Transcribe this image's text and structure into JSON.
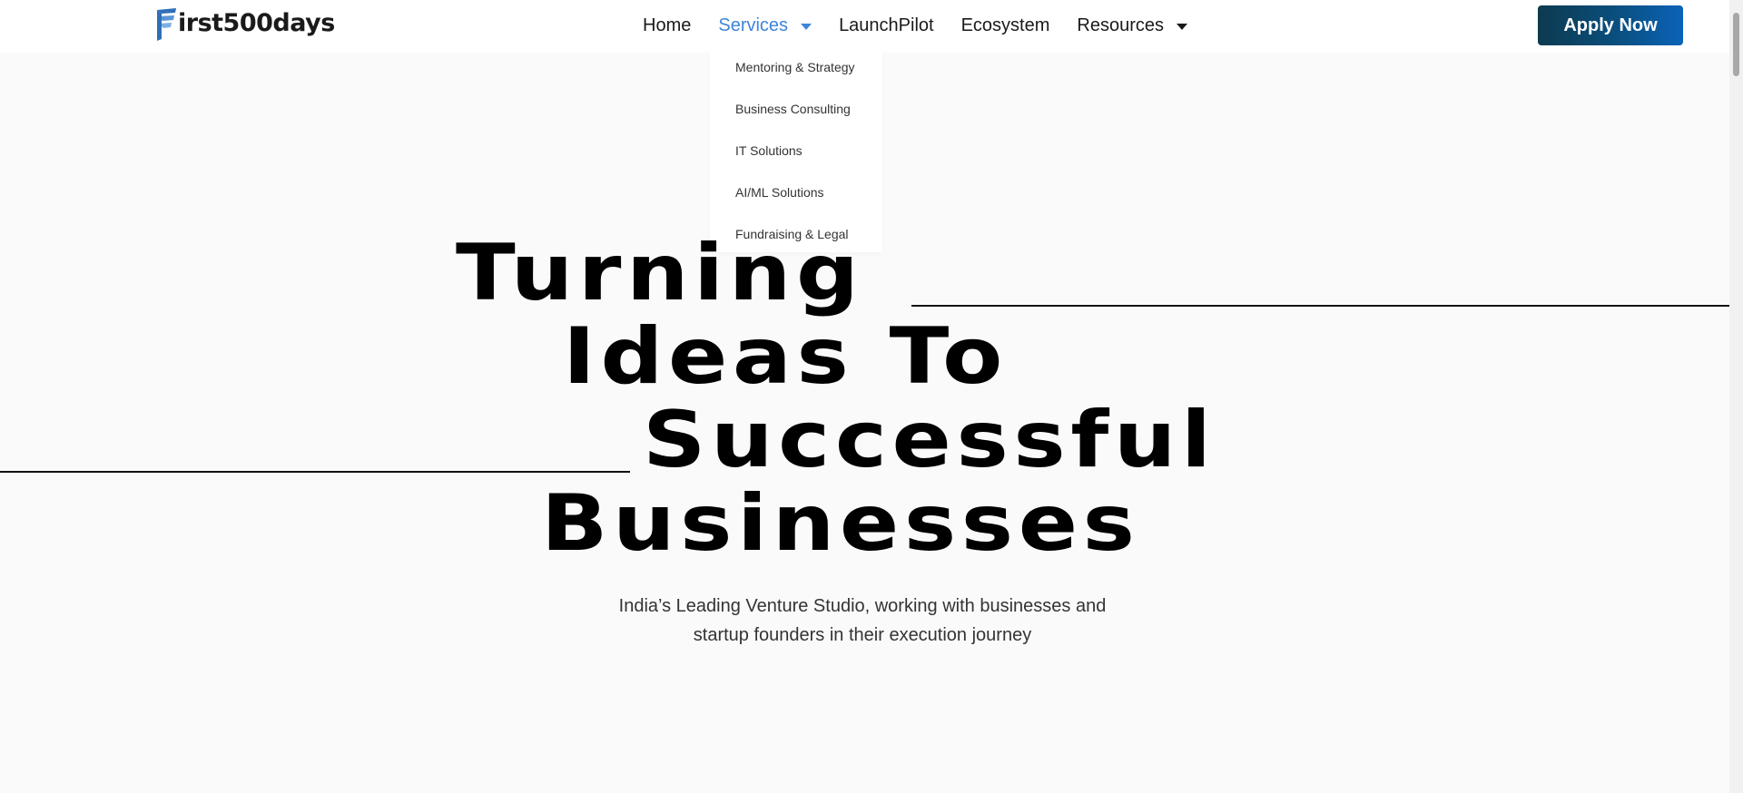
{
  "brand": {
    "logo_letter": "F",
    "logo_text": "irst500days",
    "logo_colors": [
      "#2f6fb8",
      "#7bb0e3"
    ]
  },
  "nav": {
    "items": [
      {
        "label": "Home"
      },
      {
        "label": "Services",
        "active": true,
        "has_dropdown": true
      },
      {
        "label": "LaunchPilot"
      },
      {
        "label": "Ecosystem"
      },
      {
        "label": "Resources",
        "has_dropdown": true
      }
    ],
    "apply_label": "Apply Now",
    "active_color": "#3f84d9"
  },
  "services_dropdown": {
    "items": [
      {
        "label": "Mentoring & Strategy"
      },
      {
        "label": "Business Consulting"
      },
      {
        "label": "IT Solutions"
      },
      {
        "label": "AI/ML Solutions"
      },
      {
        "label": "Fundraising & Legal"
      }
    ]
  },
  "hero": {
    "lines": [
      "Turning",
      "Ideas To",
      "Successful",
      "Businesses"
    ],
    "subtitle_line1": "India’s Leading Venture Studio, working with businesses and",
    "subtitle_line2": "startup founders in their execution journey"
  }
}
